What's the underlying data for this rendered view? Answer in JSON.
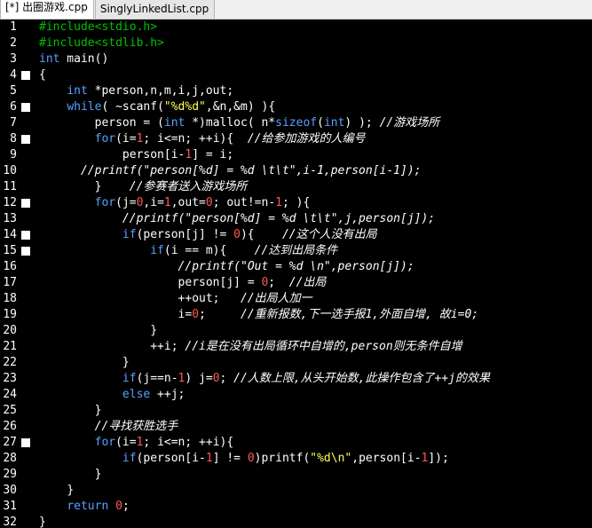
{
  "tabs": [
    {
      "label": "[*] 出圈游戏.cpp",
      "active": true
    },
    {
      "label": "SinglyLinkedList.cpp",
      "active": false
    }
  ],
  "lines": [
    {
      "n": "1",
      "fold": false,
      "indent": "",
      "tokens": [
        [
          "pp",
          "#include<stdio.h>"
        ]
      ]
    },
    {
      "n": "2",
      "fold": false,
      "indent": "",
      "tokens": [
        [
          "pp",
          "#include<stdlib.h>"
        ]
      ]
    },
    {
      "n": "3",
      "fold": false,
      "indent": "",
      "tokens": [
        [
          "kw",
          "int"
        ],
        [
          "",
          " main()"
        ]
      ]
    },
    {
      "n": "4",
      "fold": true,
      "indent": "",
      "tokens": [
        [
          "",
          "{"
        ]
      ]
    },
    {
      "n": "5",
      "fold": false,
      "indent": "    ",
      "tokens": [
        [
          "kw",
          "int"
        ],
        [
          "",
          " *person,n,m,i,j,out;"
        ]
      ]
    },
    {
      "n": "6",
      "fold": true,
      "indent": "    ",
      "tokens": [
        [
          "kw",
          "while"
        ],
        [
          "",
          "( ~scanf("
        ],
        [
          "str",
          "\"%d%d\""
        ],
        [
          "",
          ",&n,&m) ){"
        ]
      ]
    },
    {
      "n": "7",
      "fold": false,
      "indent": "        ",
      "tokens": [
        [
          "",
          "person = ("
        ],
        [
          "kw",
          "int"
        ],
        [
          "",
          " *)malloc( n*"
        ],
        [
          "kw",
          "sizeof"
        ],
        [
          "",
          "("
        ],
        [
          "kw",
          "int"
        ],
        [
          "",
          ") ); "
        ],
        [
          "cm",
          "//游戏场所"
        ]
      ]
    },
    {
      "n": "8",
      "fold": true,
      "indent": "        ",
      "tokens": [
        [
          "kw",
          "for"
        ],
        [
          "",
          "(i="
        ],
        [
          "num",
          "1"
        ],
        [
          "",
          "; i<=n; ++i){  "
        ],
        [
          "cm",
          "//给参加游戏的人编号"
        ]
      ]
    },
    {
      "n": "9",
      "fold": false,
      "indent": "            ",
      "tokens": [
        [
          "",
          "person[i-"
        ],
        [
          "num",
          "1"
        ],
        [
          "",
          "] = i;"
        ]
      ]
    },
    {
      "n": "10",
      "fold": false,
      "indent": "      ",
      "tokens": [
        [
          "cm",
          "//printf(\"person[%d] = %d \\t\\t\",i-1,person[i-1]);"
        ]
      ]
    },
    {
      "n": "11",
      "fold": false,
      "indent": "        ",
      "tokens": [
        [
          "",
          "}    "
        ],
        [
          "cm",
          "//参赛者送入游戏场所"
        ]
      ]
    },
    {
      "n": "12",
      "fold": true,
      "indent": "        ",
      "tokens": [
        [
          "kw",
          "for"
        ],
        [
          "",
          "(j="
        ],
        [
          "num",
          "0"
        ],
        [
          "",
          ",i="
        ],
        [
          "num",
          "1"
        ],
        [
          "",
          ",out="
        ],
        [
          "num",
          "0"
        ],
        [
          "",
          "; out!=n-"
        ],
        [
          "num",
          "1"
        ],
        [
          "",
          "; ){"
        ]
      ]
    },
    {
      "n": "13",
      "fold": false,
      "indent": "            ",
      "tokens": [
        [
          "cm",
          "//printf(\"person[%d] = %d \\t\\t\",j,person[j]);"
        ]
      ]
    },
    {
      "n": "14",
      "fold": true,
      "indent": "            ",
      "tokens": [
        [
          "kw",
          "if"
        ],
        [
          "",
          "(person[j] != "
        ],
        [
          "num",
          "0"
        ],
        [
          "",
          "){    "
        ],
        [
          "cm",
          "//这个人没有出局"
        ]
      ]
    },
    {
      "n": "15",
      "fold": true,
      "indent": "                ",
      "tokens": [
        [
          "kw",
          "if"
        ],
        [
          "",
          "(i == m){    "
        ],
        [
          "cm",
          "//达到出局条件"
        ]
      ]
    },
    {
      "n": "16",
      "fold": false,
      "indent": "                    ",
      "tokens": [
        [
          "cm",
          "//printf(\"Out = %d \\n\",person[j]);"
        ]
      ]
    },
    {
      "n": "17",
      "fold": false,
      "indent": "                    ",
      "tokens": [
        [
          "",
          "person[j] = "
        ],
        [
          "num",
          "0"
        ],
        [
          "",
          ";  "
        ],
        [
          "cm",
          "//出局"
        ]
      ]
    },
    {
      "n": "18",
      "fold": false,
      "indent": "                    ",
      "tokens": [
        [
          "",
          "++out;   "
        ],
        [
          "cm",
          "//出局人加一"
        ]
      ]
    },
    {
      "n": "19",
      "fold": false,
      "indent": "                    ",
      "tokens": [
        [
          "",
          "i="
        ],
        [
          "num",
          "0"
        ],
        [
          "",
          ";     "
        ],
        [
          "cm",
          "//重新报数,下一选手报1,外面自增, 故i=0;"
        ]
      ]
    },
    {
      "n": "20",
      "fold": false,
      "indent": "                ",
      "tokens": [
        [
          "",
          "}"
        ]
      ]
    },
    {
      "n": "21",
      "fold": false,
      "indent": "                ",
      "tokens": [
        [
          "",
          "++i; "
        ],
        [
          "cm",
          "//i是在没有出局循环中自增的,person则无条件自增"
        ]
      ]
    },
    {
      "n": "22",
      "fold": false,
      "indent": "            ",
      "tokens": [
        [
          "",
          "}"
        ]
      ]
    },
    {
      "n": "23",
      "fold": false,
      "indent": "            ",
      "tokens": [
        [
          "kw",
          "if"
        ],
        [
          "",
          "(j==n-"
        ],
        [
          "num",
          "1"
        ],
        [
          "",
          ") j="
        ],
        [
          "num",
          "0"
        ],
        [
          "",
          "; "
        ],
        [
          "cm",
          "//人数上限,从头开始数,此操作包含了++j的效果"
        ]
      ]
    },
    {
      "n": "24",
      "fold": false,
      "indent": "            ",
      "tokens": [
        [
          "kw",
          "else"
        ],
        [
          "",
          " ++j;"
        ]
      ]
    },
    {
      "n": "25",
      "fold": false,
      "indent": "        ",
      "tokens": [
        [
          "",
          "}"
        ]
      ]
    },
    {
      "n": "26",
      "fold": false,
      "indent": "        ",
      "tokens": [
        [
          "cm",
          "//寻找获胜选手"
        ]
      ]
    },
    {
      "n": "27",
      "fold": true,
      "indent": "        ",
      "tokens": [
        [
          "kw",
          "for"
        ],
        [
          "",
          "(i="
        ],
        [
          "num",
          "1"
        ],
        [
          "",
          "; i<=n; ++i){"
        ]
      ]
    },
    {
      "n": "28",
      "fold": false,
      "indent": "            ",
      "tokens": [
        [
          "kw",
          "if"
        ],
        [
          "",
          "(person[i-"
        ],
        [
          "num",
          "1"
        ],
        [
          "",
          "] != "
        ],
        [
          "num",
          "0"
        ],
        [
          "",
          ")printf("
        ],
        [
          "str",
          "\"%d\\n\""
        ],
        [
          "",
          ",person[i-"
        ],
        [
          "num",
          "1"
        ],
        [
          "",
          "]);"
        ]
      ]
    },
    {
      "n": "29",
      "fold": false,
      "indent": "        ",
      "tokens": [
        [
          "",
          "}"
        ]
      ]
    },
    {
      "n": "30",
      "fold": false,
      "indent": "    ",
      "tokens": [
        [
          "",
          "}"
        ]
      ]
    },
    {
      "n": "31",
      "fold": false,
      "indent": "    ",
      "tokens": [
        [
          "kw",
          "return"
        ],
        [
          "",
          " "
        ],
        [
          "num",
          "0"
        ],
        [
          "",
          ";"
        ]
      ]
    },
    {
      "n": "32",
      "fold": false,
      "indent": "",
      "tokens": [
        [
          "",
          "}"
        ]
      ]
    }
  ]
}
